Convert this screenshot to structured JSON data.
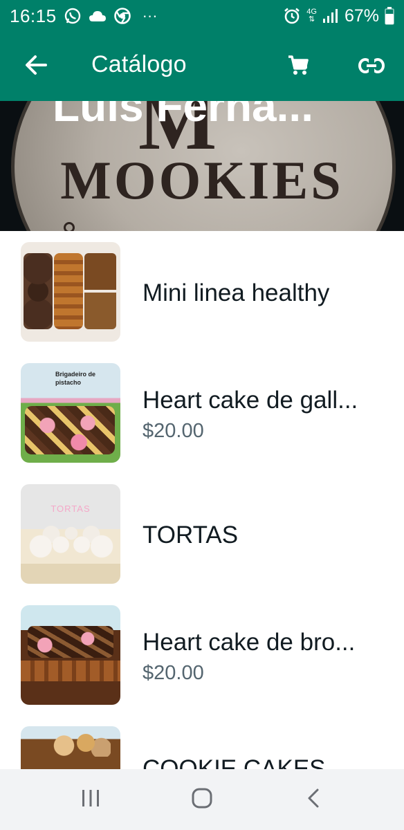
{
  "status_bar": {
    "time": "16:15",
    "notification_icons": [
      "whatsapp-icon",
      "cloud-icon",
      "chrome-icon",
      "more-dots-icon"
    ],
    "more_dots": "···",
    "network_type": "4G",
    "battery_percent": "67%",
    "right_icons": [
      "alarm-icon",
      "network-4g-icon",
      "signal-icon",
      "battery-icon"
    ]
  },
  "app_bar": {
    "title": "Catálogo",
    "background": "#008069",
    "actions": [
      "back-arrow-icon",
      "cart-icon",
      "link-icon"
    ]
  },
  "cover": {
    "business_name": "Luis Ferna...",
    "logo_text": "MOOKIES",
    "monogram": "M"
  },
  "products": [
    {
      "title": "Mini linea healthy",
      "price": ""
    },
    {
      "title": "Heart cake de gall...",
      "price": "$20.00",
      "thumb_label": "Brigadeiro de pistacho"
    },
    {
      "title": "TORTAS",
      "price": "",
      "thumb_label": "TORTAS"
    },
    {
      "title": "Heart cake de bro...",
      "price": "$20.00"
    },
    {
      "title": "COOKIE CAKES",
      "price": ""
    }
  ],
  "nav_bar": {
    "buttons": [
      "recent-apps-icon",
      "home-icon",
      "back-icon"
    ]
  }
}
